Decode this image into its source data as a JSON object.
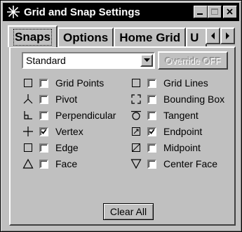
{
  "window": {
    "title": "Grid and Snap Settings",
    "minimize_icon": "minimize-icon",
    "close_icon": "close-icon"
  },
  "tabs": [
    {
      "label": "Snaps",
      "active": true
    },
    {
      "label": "Options",
      "active": false
    },
    {
      "label": "Home Grid",
      "active": false
    },
    {
      "label": "U",
      "active": false
    }
  ],
  "tab_scroll": {
    "left_icon": "arrow-left-icon",
    "right_icon": "arrow-right-icon"
  },
  "snap_set": {
    "selected": "Standard"
  },
  "override_button": {
    "label": "Override OFF",
    "enabled": false
  },
  "snaps_left": [
    {
      "label": "Grid Points",
      "icon": "grid-points-icon",
      "checked": false
    },
    {
      "label": "Pivot",
      "icon": "pivot-icon",
      "checked": false
    },
    {
      "label": "Perpendicular",
      "icon": "perpendicular-icon",
      "checked": false
    },
    {
      "label": "Vertex",
      "icon": "vertex-icon",
      "checked": true
    },
    {
      "label": "Edge",
      "icon": "edge-icon",
      "checked": false
    },
    {
      "label": "Face",
      "icon": "face-icon",
      "checked": false
    }
  ],
  "snaps_right": [
    {
      "label": "Grid Lines",
      "icon": "grid-lines-icon",
      "checked": false
    },
    {
      "label": "Bounding Box",
      "icon": "bounding-box-icon",
      "checked": false
    },
    {
      "label": "Tangent",
      "icon": "tangent-icon",
      "checked": false
    },
    {
      "label": "Endpoint",
      "icon": "endpoint-icon",
      "checked": true
    },
    {
      "label": "Midpoint",
      "icon": "midpoint-icon",
      "checked": false
    },
    {
      "label": "Center Face",
      "icon": "center-face-icon",
      "checked": false
    }
  ],
  "clear_all": {
    "label": "Clear All"
  }
}
